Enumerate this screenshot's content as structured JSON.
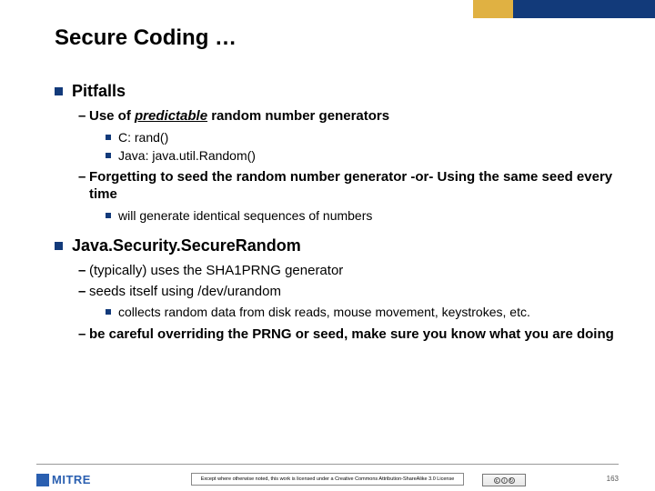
{
  "title": "Secure Coding …",
  "sections": [
    {
      "heading": "Pitfalls",
      "items": [
        {
          "text_pre": "Use of ",
          "text_emph": "predictable",
          "text_post": " random number generators",
          "subitems": [
            {
              "text": "C: rand()"
            },
            {
              "text": "Java: java.util.Random()"
            }
          ]
        },
        {
          "text": "Forgetting to seed the random number generator  -or-  Using the same seed every time",
          "subitems": [
            {
              "text": "will generate identical sequences of numbers"
            }
          ]
        }
      ]
    },
    {
      "heading": "Java.Security.SecureRandom",
      "items": [
        {
          "text": "(typically) uses the SHA1PRNG generator",
          "plain": true
        },
        {
          "text": "seeds itself using /dev/urandom",
          "plain": true,
          "subitems": [
            {
              "text": "collects random data from disk reads, mouse movement, keystrokes, etc."
            }
          ]
        },
        {
          "text": "be careful overriding the PRNG or seed, make sure you know what you are doing"
        }
      ]
    }
  ],
  "footer": {
    "logo": "MITRE",
    "license": "Except where otherwise noted, this work is licensed under a Creative Commons Attribution-ShareAlike 3.0 License",
    "cc_label": "CC",
    "page_number": "163"
  }
}
